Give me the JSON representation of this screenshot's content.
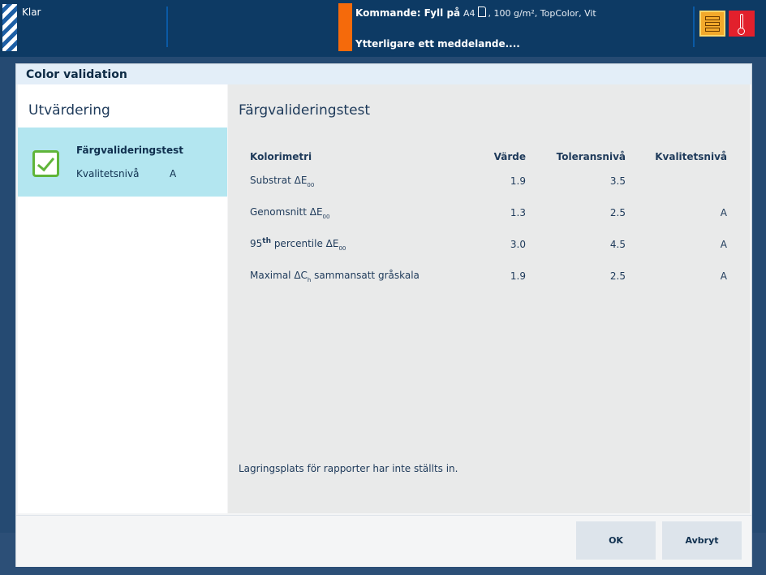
{
  "topbar": {
    "status": "Klar",
    "command_label": "Kommande: Fyll på",
    "paper_size": "A4",
    "paper_details": ", 100 g/m², TopColor, Vit",
    "message": "Ytterligare ett meddelande....",
    "icons": [
      "paper-tray-icon",
      "thermometer-icon"
    ],
    "colors": {
      "bar": "#0d3a64",
      "warning": "#f56a0b",
      "tray": "#f2a92b",
      "temperature": "#e2202c"
    }
  },
  "dialog": {
    "title": "Color validation",
    "left": {
      "heading": "Utvärdering",
      "card": {
        "title": "Färgvalideringstest",
        "label": "Kvalitetsnivå",
        "value": "A",
        "icon": "check-icon"
      }
    },
    "right": {
      "heading": "Färgvalideringstest",
      "table": {
        "headers": [
          "Kolorimetri",
          "Värde",
          "Toleransnivå",
          "Kvalitetsnivå"
        ],
        "rows": [
          {
            "pre": "",
            "sup": "",
            "main": "Substrat ΔE",
            "sub": "00",
            "post": "",
            "value": "1.9",
            "tolerance": "3.5",
            "quality": ""
          },
          {
            "pre": "",
            "sup": "",
            "main": "Genomsnitt ΔE",
            "sub": "00",
            "post": "",
            "value": "1.3",
            "tolerance": "2.5",
            "quality": "A"
          },
          {
            "pre": "95",
            "sup": "th",
            "main": " percentile ΔE",
            "sub": "00",
            "post": "",
            "value": "3.0",
            "tolerance": "4.5",
            "quality": "A"
          },
          {
            "pre": "",
            "sup": "",
            "main": "Maximal ΔC",
            "sub": "h",
            "post": " sammansatt gråskala",
            "value": "1.9",
            "tolerance": "2.5",
            "quality": "A"
          }
        ]
      },
      "note": "Lagringsplats för rapporter har inte ställts in."
    },
    "buttons": {
      "ok": "OK",
      "cancel": "Avbryt"
    }
  }
}
